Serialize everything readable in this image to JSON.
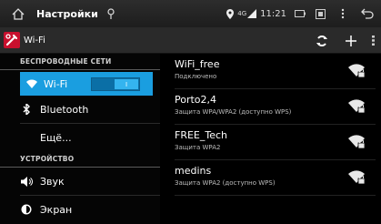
{
  "statusbar": {
    "title": "Настройки",
    "network_type": "4G",
    "time": "11:21"
  },
  "appbar": {
    "title": "Wi-Fi"
  },
  "sidebar": {
    "section_wireless": "БЕСПРОВОДНЫЕ СЕТИ",
    "wifi_label": "Wi-Fi",
    "wifi_toggle": "I",
    "bluetooth_label": "Bluetooth",
    "more_label": "Ещё...",
    "section_device": "УСТРОЙСТВО",
    "sound_label": "Звук",
    "display_label": "Экран"
  },
  "networks": [
    {
      "name": "WiFi_free",
      "status": "Подключено"
    },
    {
      "name": "Porto2,4",
      "status": "Защита WPA/WPA2 (доступно WPS)"
    },
    {
      "name": "FREE_Tech",
      "status": "Защита WPA2"
    },
    {
      "name": "medins",
      "status": "Защита WPA2 (доступно WPS)"
    }
  ],
  "colors": {
    "accent": "#1a9ee0",
    "background": "#000000",
    "app_icon": "#c8102e"
  }
}
